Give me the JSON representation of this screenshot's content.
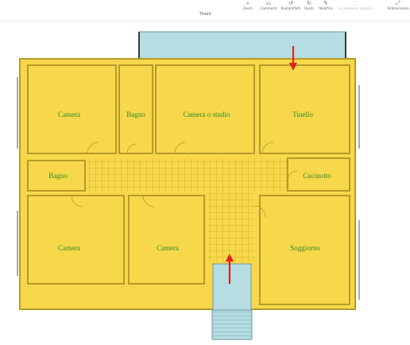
{
  "toolbar": {
    "document_title": "Tinelli",
    "tools": [
      {
        "label": "Zoom",
        "icon": "zoom-icon",
        "glyph": "⌕"
      },
      {
        "label": "Commenti",
        "icon": "comment-icon",
        "glyph": "▭"
      },
      {
        "label": "Ruota/rifletti",
        "icon": "rotate-icon",
        "glyph": "↺"
      },
      {
        "label": "Ruota",
        "icon": "rotate-right-icon",
        "glyph": "↻"
      },
      {
        "label": "Modifica",
        "icon": "edit-icon",
        "glyph": "✎"
      },
      {
        "label": "La selezione: Scegli il",
        "icon": "select-icon",
        "glyph": "⬚"
      },
      {
        "label": "Ridimensiona",
        "icon": "resize-icon",
        "glyph": "⤢"
      }
    ]
  },
  "colors": {
    "room_fill": "#f7d84a",
    "wall": "#b59a2a",
    "balcony_fill": "#b5dde3",
    "tile_grid": "#c9aa2a",
    "label": "#2e8a2e",
    "arrow": "#e02020"
  },
  "floorplan": {
    "rooms": [
      {
        "id": "camera-1",
        "label": "Camera"
      },
      {
        "id": "bagno-1",
        "label": "Bagno"
      },
      {
        "id": "camera-studio",
        "label": "Camera o studio"
      },
      {
        "id": "tinello",
        "label": "Tinello"
      },
      {
        "id": "bagno-2",
        "label": "Bagno"
      },
      {
        "id": "cucinotto",
        "label": "Cucinotto"
      },
      {
        "id": "camera-2",
        "label": "Camera"
      },
      {
        "id": "camera-3",
        "label": "Camera"
      },
      {
        "id": "soggiorno",
        "label": "Soggiorno"
      }
    ],
    "entry_arrows": [
      {
        "id": "balcony-arrow",
        "direction": "down"
      },
      {
        "id": "entrance-arrow",
        "direction": "up"
      }
    ]
  }
}
